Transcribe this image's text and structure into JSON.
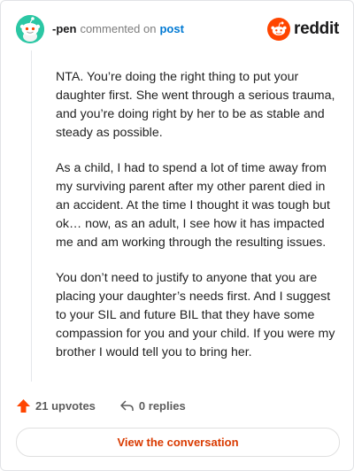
{
  "header": {
    "username": "-pen",
    "verb": "commented on",
    "target": "post",
    "avatar_color": "#2bc7a4"
  },
  "brand": {
    "wordmark": "reddit",
    "logo_icon": "reddit-snoo-icon",
    "logo_color": "#ff4500"
  },
  "comment": {
    "paragraphs": [
      "NTA. You’re doing the right thing to put your daughter first. She went through a serious trauma, and you’re doing right by her to be as stable and steady as possible.",
      "As a child, I had to spend a lot of time away from my surviving parent after my other parent died in an accident. At the time I thought it was tough but ok… now, as an adult, I see how it has impacted me and am working through the resulting issues.",
      "You don’t need to justify to anyone that you are placing your daughter’s needs first. And I suggest to your SIL and future BIL that they have some compassion for you and your child. If you were my brother I would tell you to bring her."
    ]
  },
  "actions": {
    "upvotes": "21 upvotes",
    "replies": "0 replies",
    "upvote_icon": "upvote-arrow-icon",
    "reply_icon": "reply-arrow-icon",
    "upvote_color": "#ff4500"
  },
  "footer": {
    "view_label": "View the conversation",
    "accent": "#d93a00"
  }
}
